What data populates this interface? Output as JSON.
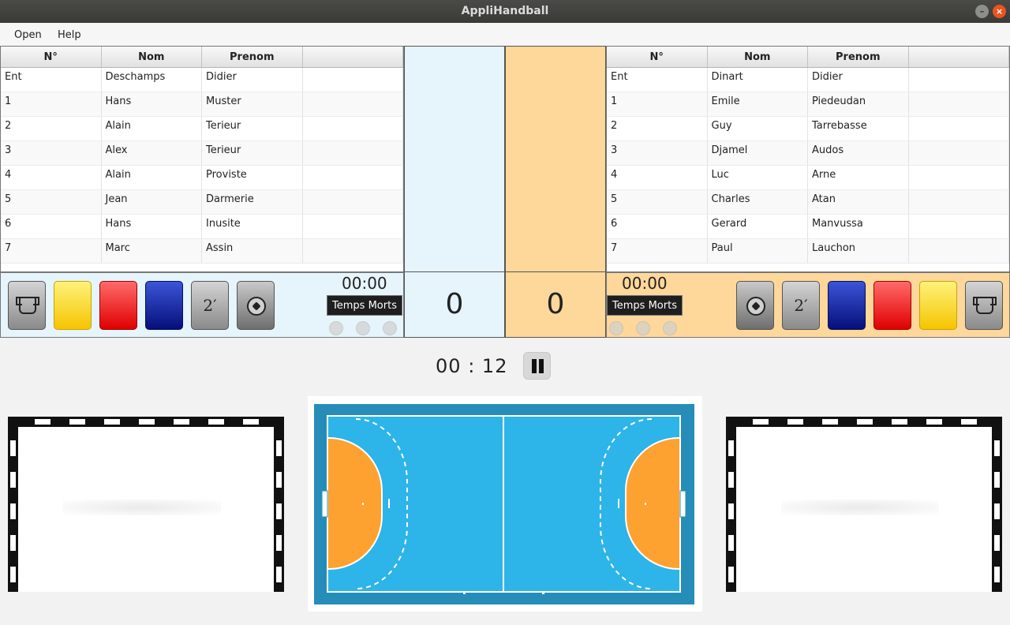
{
  "window": {
    "title": "AppliHandball",
    "minimize_label": "–",
    "close_label": "×"
  },
  "menu": {
    "open": "Open",
    "help": "Help"
  },
  "left_team": {
    "headers": [
      "N°",
      "Nom",
      "Prenom",
      ""
    ],
    "rows": [
      [
        "Ent",
        "Deschamps",
        "Didier"
      ],
      [
        "1",
        "Hans",
        "Muster"
      ],
      [
        "2",
        "Alain",
        "Terieur"
      ],
      [
        "3",
        "Alex",
        "Terieur"
      ],
      [
        "4",
        "Alain",
        "Proviste"
      ],
      [
        "5",
        "Jean",
        "Darmerie"
      ],
      [
        "6",
        "Hans",
        "Inusite"
      ],
      [
        "7",
        "Marc",
        "Assin"
      ]
    ],
    "score": "0",
    "timeout_time": "00:00",
    "timeout_label": "Temps Morts",
    "color": "#e6f4fc"
  },
  "right_team": {
    "headers": [
      "N°",
      "Nom",
      "Prenom",
      ""
    ],
    "rows": [
      [
        "Ent",
        "Dinart",
        "Didier"
      ],
      [
        "1",
        "Emile",
        "Piedeudan"
      ],
      [
        "2",
        "Guy",
        "Tarrebasse"
      ],
      [
        "3",
        "Djamel",
        "Audos"
      ],
      [
        "4",
        "Luc",
        "Arne"
      ],
      [
        "5",
        "Charles",
        "Atan"
      ],
      [
        "6",
        "Gerard",
        "Manvussa"
      ],
      [
        "7",
        "Paul",
        "Lauchon"
      ]
    ],
    "score": "0",
    "timeout_time": "00:00",
    "timeout_label": "Temps Morts",
    "color": "#fed79a"
  },
  "buttons": {
    "two_min_label": "2′"
  },
  "match": {
    "minutes": "00",
    "separator": ":",
    "seconds": "12"
  },
  "icons": [
    "substitution-icon",
    "yellow-card",
    "red-card",
    "blue-card",
    "two-minute-suspension",
    "goal-ball-icon",
    "pause-icon"
  ]
}
